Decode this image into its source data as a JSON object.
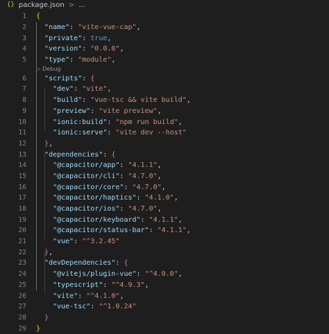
{
  "breadcrumb": {
    "icon": "{}",
    "file": "package.json",
    "separator": ">",
    "more": "..."
  },
  "codelens": {
    "label": "Debug"
  },
  "lines": [
    {
      "n": "1"
    },
    {
      "n": "2"
    },
    {
      "n": "3"
    },
    {
      "n": "4"
    },
    {
      "n": "5"
    },
    {
      "n": "6"
    },
    {
      "n": "7"
    },
    {
      "n": "8"
    },
    {
      "n": "9"
    },
    {
      "n": "10"
    },
    {
      "n": "11"
    },
    {
      "n": "12"
    },
    {
      "n": "13"
    },
    {
      "n": "14"
    },
    {
      "n": "15"
    },
    {
      "n": "16"
    },
    {
      "n": "17"
    },
    {
      "n": "18"
    },
    {
      "n": "19"
    },
    {
      "n": "20"
    },
    {
      "n": "21"
    },
    {
      "n": "22"
    },
    {
      "n": "23"
    },
    {
      "n": "24"
    },
    {
      "n": "25"
    },
    {
      "n": "26"
    },
    {
      "n": "27"
    },
    {
      "n": "28"
    },
    {
      "n": "29"
    }
  ],
  "code": {
    "l1": "{",
    "name_k": "\"name\"",
    "name_v": "\"vite-vue-cap\"",
    "private_k": "\"private\"",
    "private_v": "true",
    "version_k": "\"version\"",
    "version_v": "\"0.0.0\"",
    "type_k": "\"type\"",
    "type_v": "\"module\"",
    "scripts_k": "\"scripts\"",
    "dev_k": "\"dev\"",
    "dev_v": "\"vite\"",
    "build_k": "\"build\"",
    "build_v": "\"vue-tsc && vite build\"",
    "preview_k": "\"preview\"",
    "preview_v": "\"vite preview\"",
    "ionicbuild_k": "\"ionic:build\"",
    "ionicbuild_v": "\"npm run build\"",
    "ionicserve_k": "\"ionic:serve\"",
    "ionicserve_v": "\"vite dev --host\"",
    "deps_k": "\"dependencies\"",
    "cap_app_k": "\"@capacitor/app\"",
    "cap_app_v": "\"4.1.1\"",
    "cap_cli_k": "\"@capacitor/cli\"",
    "cap_cli_v": "\"4.7.0\"",
    "cap_core_k": "\"@capacitor/core\"",
    "cap_core_v": "\"4.7.0\"",
    "cap_haptics_k": "\"@capacitor/haptics\"",
    "cap_haptics_v": "\"4.1.0\"",
    "cap_ios_k": "\"@capacitor/ios\"",
    "cap_ios_v": "\"4.7.0\"",
    "cap_keyboard_k": "\"@capacitor/keyboard\"",
    "cap_keyboard_v": "\"4.1.1\"",
    "cap_statusbar_k": "\"@capacitor/status-bar\"",
    "cap_statusbar_v": "\"4.1.1\"",
    "vue_k": "\"vue\"",
    "vue_v": "\"^3.2.45\"",
    "devdeps_k": "\"devDependencies\"",
    "pluginvue_k": "\"@vitejs/plugin-vue\"",
    "pluginvue_v": "\"^4.0.0\"",
    "typescript_k": "\"typescript\"",
    "typescript_v": "\"^4.9.3\"",
    "vite_k": "\"vite\"",
    "vite_v": "\"^4.1.0\"",
    "vuetsc_k": "\"vue-tsc\"",
    "vuetsc_v": "\"^1.0.24\"",
    "l29": "}"
  }
}
